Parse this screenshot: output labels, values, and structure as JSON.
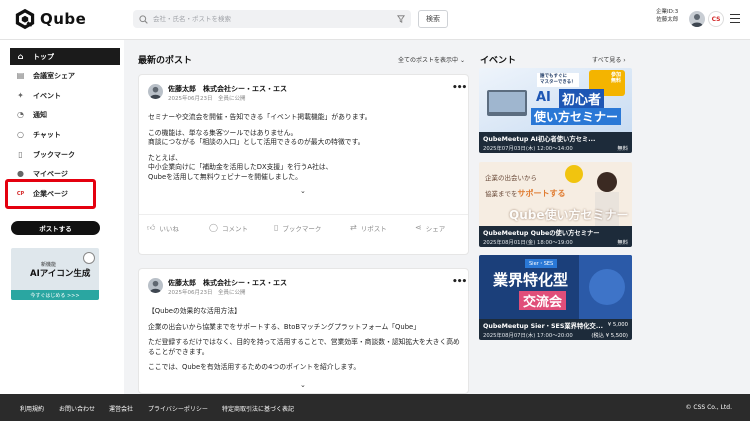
{
  "header": {
    "logo_text": "Qube",
    "search_placeholder": "会社・氏名・ポストを検索",
    "search_button": "検索",
    "company_line1": "企業ID:3",
    "company_line2": "佐藤太郎",
    "badge_text": "CS"
  },
  "sidebar": {
    "items": [
      {
        "label": "トップ",
        "icon": "home-icon"
      },
      {
        "label": "会議室シェア",
        "icon": "meeting-room-icon"
      },
      {
        "label": "イベント",
        "icon": "sparkle-icon"
      },
      {
        "label": "通知",
        "icon": "bell-icon"
      },
      {
        "label": "チャット",
        "icon": "chat-icon"
      },
      {
        "label": "ブックマーク",
        "icon": "bookmark-icon"
      },
      {
        "label": "マイページ",
        "icon": "user-icon"
      },
      {
        "label": "企業ページ",
        "icon": "company-icon"
      }
    ],
    "post_button": "ポストする",
    "promo": {
      "small": "新機能",
      "big": "AIアイコン生成",
      "button": "今すぐはじめる >>>"
    }
  },
  "posts_section": {
    "title": "最新のポスト",
    "filter": "全てのポストを表示中"
  },
  "posts": [
    {
      "author": "佐藤太郎　株式会社シー・エス・エス",
      "meta": "2025年06月23日　全員に公開",
      "paragraphs": [
        "セミナーや交流会を開催・告知できる「イベント掲載機能」があります。",
        "この機能は、単なる集客ツールではありません。\n商談につながる「相談の入口」として活用できるのが最大の特徴です。",
        "たとえば、\n中小企業向けに「補助金を活用したDX支援」を行うA社は、\nQubeを活用して無料ウェビナーを開催しました。"
      ],
      "actions": [
        "いいね",
        "コメント",
        "ブックマーク",
        "リポスト",
        "シェア"
      ]
    },
    {
      "author": "佐藤太郎　株式会社シー・エス・エス",
      "meta": "2025年06月23日　全員に公開",
      "paragraphs": [
        "【Qubeの効果的な活用方法】",
        "企業の出会いから協業までをサポートする、BtoBマッチングプラットフォーム「Qube」",
        "ただ登録するだけではなく、目的を持って活用することで、営業効率・商談数・認知拡大を大きく高めることができます。",
        "ここでは、Qubeを有効活用するための4つのポイントを紹介します。"
      ]
    }
  ],
  "events_section": {
    "title": "イベント",
    "see_all": "すべて見る"
  },
  "events": [
    {
      "title": "QubeMeetup AI初心者使い方セミ...",
      "date": "2025年07月03日(木) 12:00～14:00",
      "price": "無料",
      "img_small": "誰でもすぐに\nマスターできる！",
      "img_badge": "参加\n無料",
      "img_ai": "AI",
      "img_line1": "初心者",
      "img_line2": "使い方セミナー"
    },
    {
      "title": "QubeMeetup Qubeの使い方セミナー",
      "date": "2025年08月01日(金) 18:00～19:00",
      "price": "無料",
      "img_line1": "企業の出会いから",
      "img_line2": "協業までを",
      "img_accent": "サポートする",
      "img_line3": "Qube使い方セミナー"
    },
    {
      "title": "QubeMeetup Sier・SES業界特化交...",
      "date": "2025年08月07日(木) 17:00～20:00",
      "price": "¥ 5,000",
      "price2": "(税込 ¥ 5,500)",
      "img_small": "Sier・SES",
      "img_line1": "業界特化型",
      "img_line2": "交流会"
    }
  ],
  "footer": {
    "links": [
      "利用規約",
      "お問い合わせ",
      "運営会社",
      "プライバシーポリシー",
      "特定商取引法に基づく表記"
    ],
    "copyright": "© CSS Co., Ltd."
  }
}
